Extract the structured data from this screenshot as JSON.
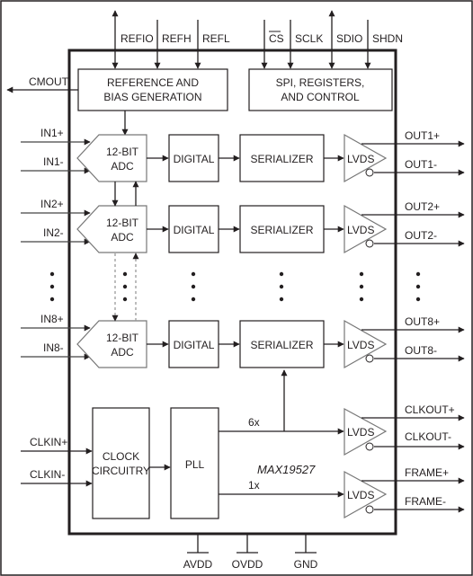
{
  "part_number": "MAX19527",
  "top_pins": {
    "reference": [
      {
        "label": "REFIO",
        "direction": "bidirectional"
      },
      {
        "label": "REFH",
        "direction": "input"
      },
      {
        "label": "REFL",
        "direction": "input"
      }
    ],
    "control": [
      {
        "label": "CS",
        "overbar": true,
        "direction": "input"
      },
      {
        "label": "SCLK",
        "direction": "input"
      },
      {
        "label": "SDIO",
        "direction": "bidirectional"
      },
      {
        "label": "SHDN",
        "direction": "input"
      }
    ]
  },
  "blocks": {
    "reference": [
      "REFERENCE AND",
      "BIAS GENERATION"
    ],
    "spi": [
      "SPI, REGISTERS,",
      "AND CONTROL"
    ],
    "adc": [
      "12-BIT",
      "ADC"
    ],
    "digital": "DIGITAL",
    "serializer": "SERIALIZER",
    "lvds": "LVDS",
    "clock": [
      "CLOCK",
      "CIRCUITRY"
    ],
    "pll": "PLL"
  },
  "cmout": "CMOUT",
  "channels": [
    {
      "in_pos": "IN1+",
      "in_neg": "IN1-",
      "out_pos": "OUT1+",
      "out_neg": "OUT1-"
    },
    {
      "in_pos": "IN2+",
      "in_neg": "IN2-",
      "out_pos": "OUT2+",
      "out_neg": "OUT2-"
    },
    {
      "in_pos": "IN8+",
      "in_neg": "IN8-",
      "out_pos": "OUT8+",
      "out_neg": "OUT8-"
    }
  ],
  "clock_inputs": {
    "pos": "CLKIN+",
    "neg": "CLKIN-"
  },
  "pll_outputs": {
    "fast": "6x",
    "frame": "1x"
  },
  "clock_outputs": {
    "pos": "CLKOUT+",
    "neg": "CLKOUT-"
  },
  "frame_outputs": {
    "pos": "FRAME+",
    "neg": "FRAME-"
  },
  "bottom_pins": [
    "AVDD",
    "OVDD",
    "GND"
  ]
}
